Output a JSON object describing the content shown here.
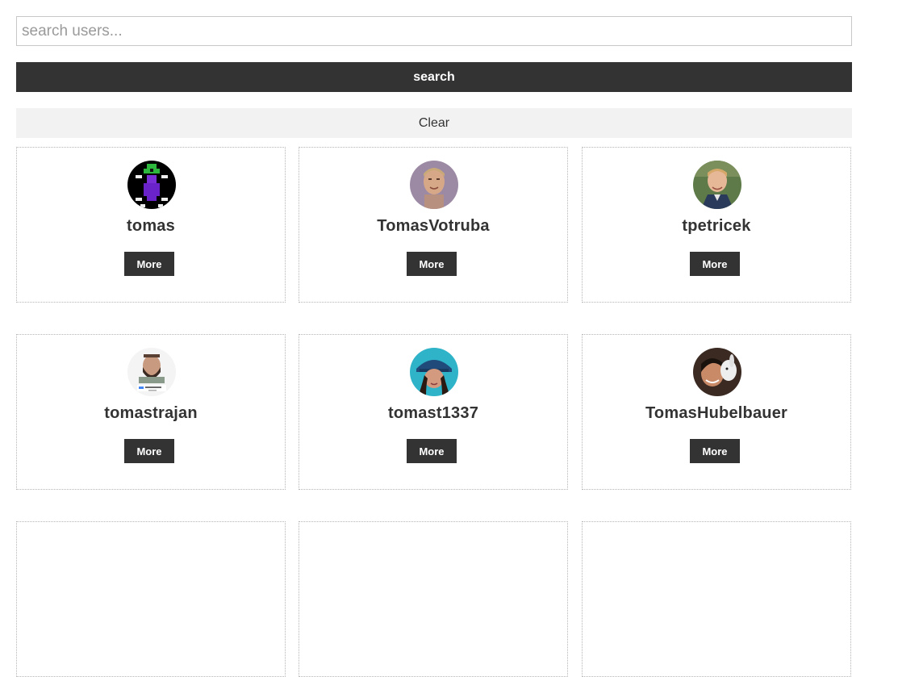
{
  "search": {
    "placeholder": "search users...",
    "value": "",
    "button_label": "search",
    "clear_label": "Clear"
  },
  "users": [
    {
      "login": "tomas",
      "more_label": "More",
      "avatar": "pixel-character-avatar"
    },
    {
      "login": "TomasVotruba",
      "more_label": "More",
      "avatar": "photo-avatar"
    },
    {
      "login": "tpetricek",
      "more_label": "More",
      "avatar": "photo-avatar"
    },
    {
      "login": "tomastrajan",
      "more_label": "More",
      "avatar": "photo-avatar"
    },
    {
      "login": "tomast1337",
      "more_label": "More",
      "avatar": "photo-avatar"
    },
    {
      "login": "TomasHubelbauer",
      "more_label": "More",
      "avatar": "photo-avatar"
    }
  ],
  "colors": {
    "primary_button": "#333333",
    "clear_button": "#f2f2f2",
    "card_border": "#b5b5b5"
  }
}
